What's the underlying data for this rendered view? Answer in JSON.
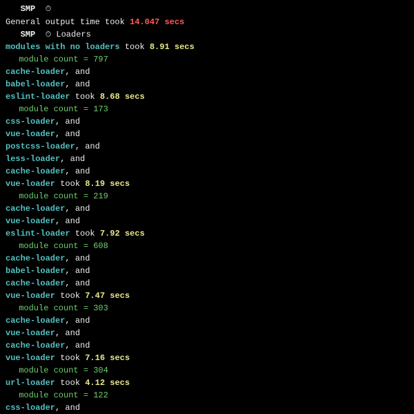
{
  "header": {
    "smp_label": " SMP ",
    "icon": "⏱",
    "general_prefix": "General output time took ",
    "general_time": "14.047 secs"
  },
  "loaders_header": {
    "smp_label": " SMP ",
    "icon": "⏱",
    "title": " Loaders"
  },
  "and_word": ", and",
  "took_word": " took ",
  "count_label": " module count = ",
  "groups": [
    {
      "chain": [
        "modules with no loaders"
      ],
      "time": "8.91 secs",
      "count": "797"
    },
    {
      "chain": [
        "cache-loader",
        "babel-loader",
        "eslint-loader"
      ],
      "time": "8.68 secs",
      "count": "173"
    },
    {
      "chain": [
        "css-loader",
        "vue-loader",
        "postcss-loader",
        "less-loader",
        "cache-loader",
        "vue-loader"
      ],
      "time": "8.19 secs",
      "count": "219"
    },
    {
      "chain": [
        "cache-loader",
        "vue-loader",
        "eslint-loader"
      ],
      "time": "7.92 secs",
      "count": "608"
    },
    {
      "chain": [
        "cache-loader",
        "babel-loader",
        "cache-loader",
        "vue-loader"
      ],
      "time": "7.47 secs",
      "count": "303"
    },
    {
      "chain": [
        "cache-loader",
        "vue-loader",
        "cache-loader",
        "vue-loader"
      ],
      "time": "7.16 secs",
      "count": "304"
    },
    {
      "chain": [
        "url-loader"
      ],
      "time": "4.12 secs",
      "count": "122"
    },
    {
      "chain": [
        "css-loader"
      ],
      "time": null,
      "count": null
    }
  ]
}
